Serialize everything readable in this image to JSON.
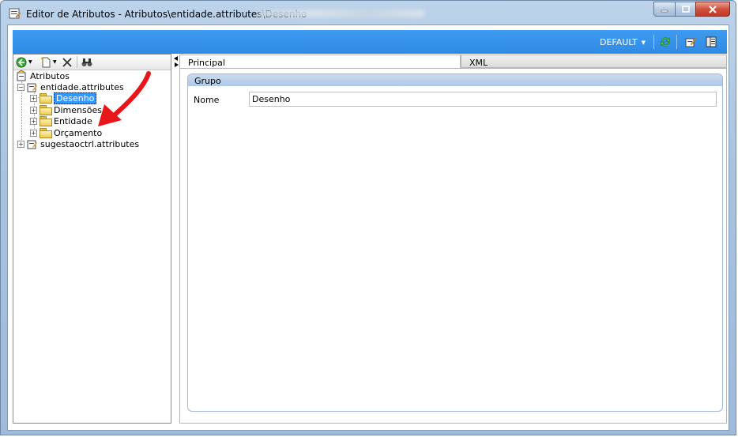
{
  "window": {
    "title": "Editor de Atributos - Atributos\\entidade.attributes\\Desenho"
  },
  "ribbon": {
    "profile_label": "DEFAULT"
  },
  "tree": {
    "root": "Atributos",
    "items": [
      {
        "label": "entidade.attributes"
      },
      {
        "label": "Desenho"
      },
      {
        "label": "Dimensões"
      },
      {
        "label": "Entidade"
      },
      {
        "label": "Orçamento"
      },
      {
        "label": "sugestaoctrl.attributes"
      }
    ]
  },
  "tabs": [
    {
      "label": "Principal"
    },
    {
      "label": "XML"
    }
  ],
  "group": {
    "header": "Grupo",
    "nome_label": "Nome",
    "nome_value": "Desenho"
  },
  "colors": {
    "ribbon": "#2f8ae6",
    "selection": "#3399ff",
    "annotation_arrow": "#e8151b"
  }
}
